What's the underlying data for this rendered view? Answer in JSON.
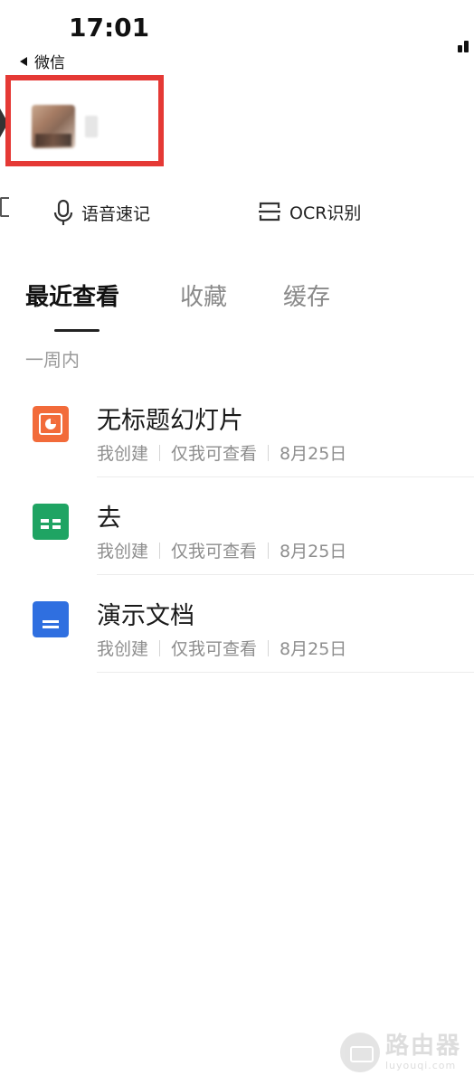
{
  "status_bar": {
    "time": "17:01",
    "back_label": "微信"
  },
  "quick_actions": {
    "voice_note": "语音速记",
    "ocr": "OCR识别"
  },
  "tabs": {
    "recent": "最近查看",
    "favorites": "收藏",
    "cache": "缓存",
    "active": "recent"
  },
  "section_label": "一周内",
  "documents": [
    {
      "title": "无标题幻灯片",
      "creator": "我创建",
      "permission": "仅我可查看",
      "date": "8月25日",
      "type": "slides",
      "icon_color": "#f26b3a"
    },
    {
      "title": "去",
      "creator": "我创建",
      "permission": "仅我可查看",
      "date": "8月25日",
      "type": "sheet",
      "icon_color": "#1fa463"
    },
    {
      "title": "演示文档",
      "creator": "我创建",
      "permission": "仅我可查看",
      "date": "8月25日",
      "type": "doc",
      "icon_color": "#2f6fe0"
    }
  ],
  "watermark": {
    "main": "路由器",
    "sub": "luyouqi.com"
  },
  "colors": {
    "highlight": "#e53935",
    "active_tab": "#111111",
    "inactive_tab": "#8a8a8a"
  }
}
